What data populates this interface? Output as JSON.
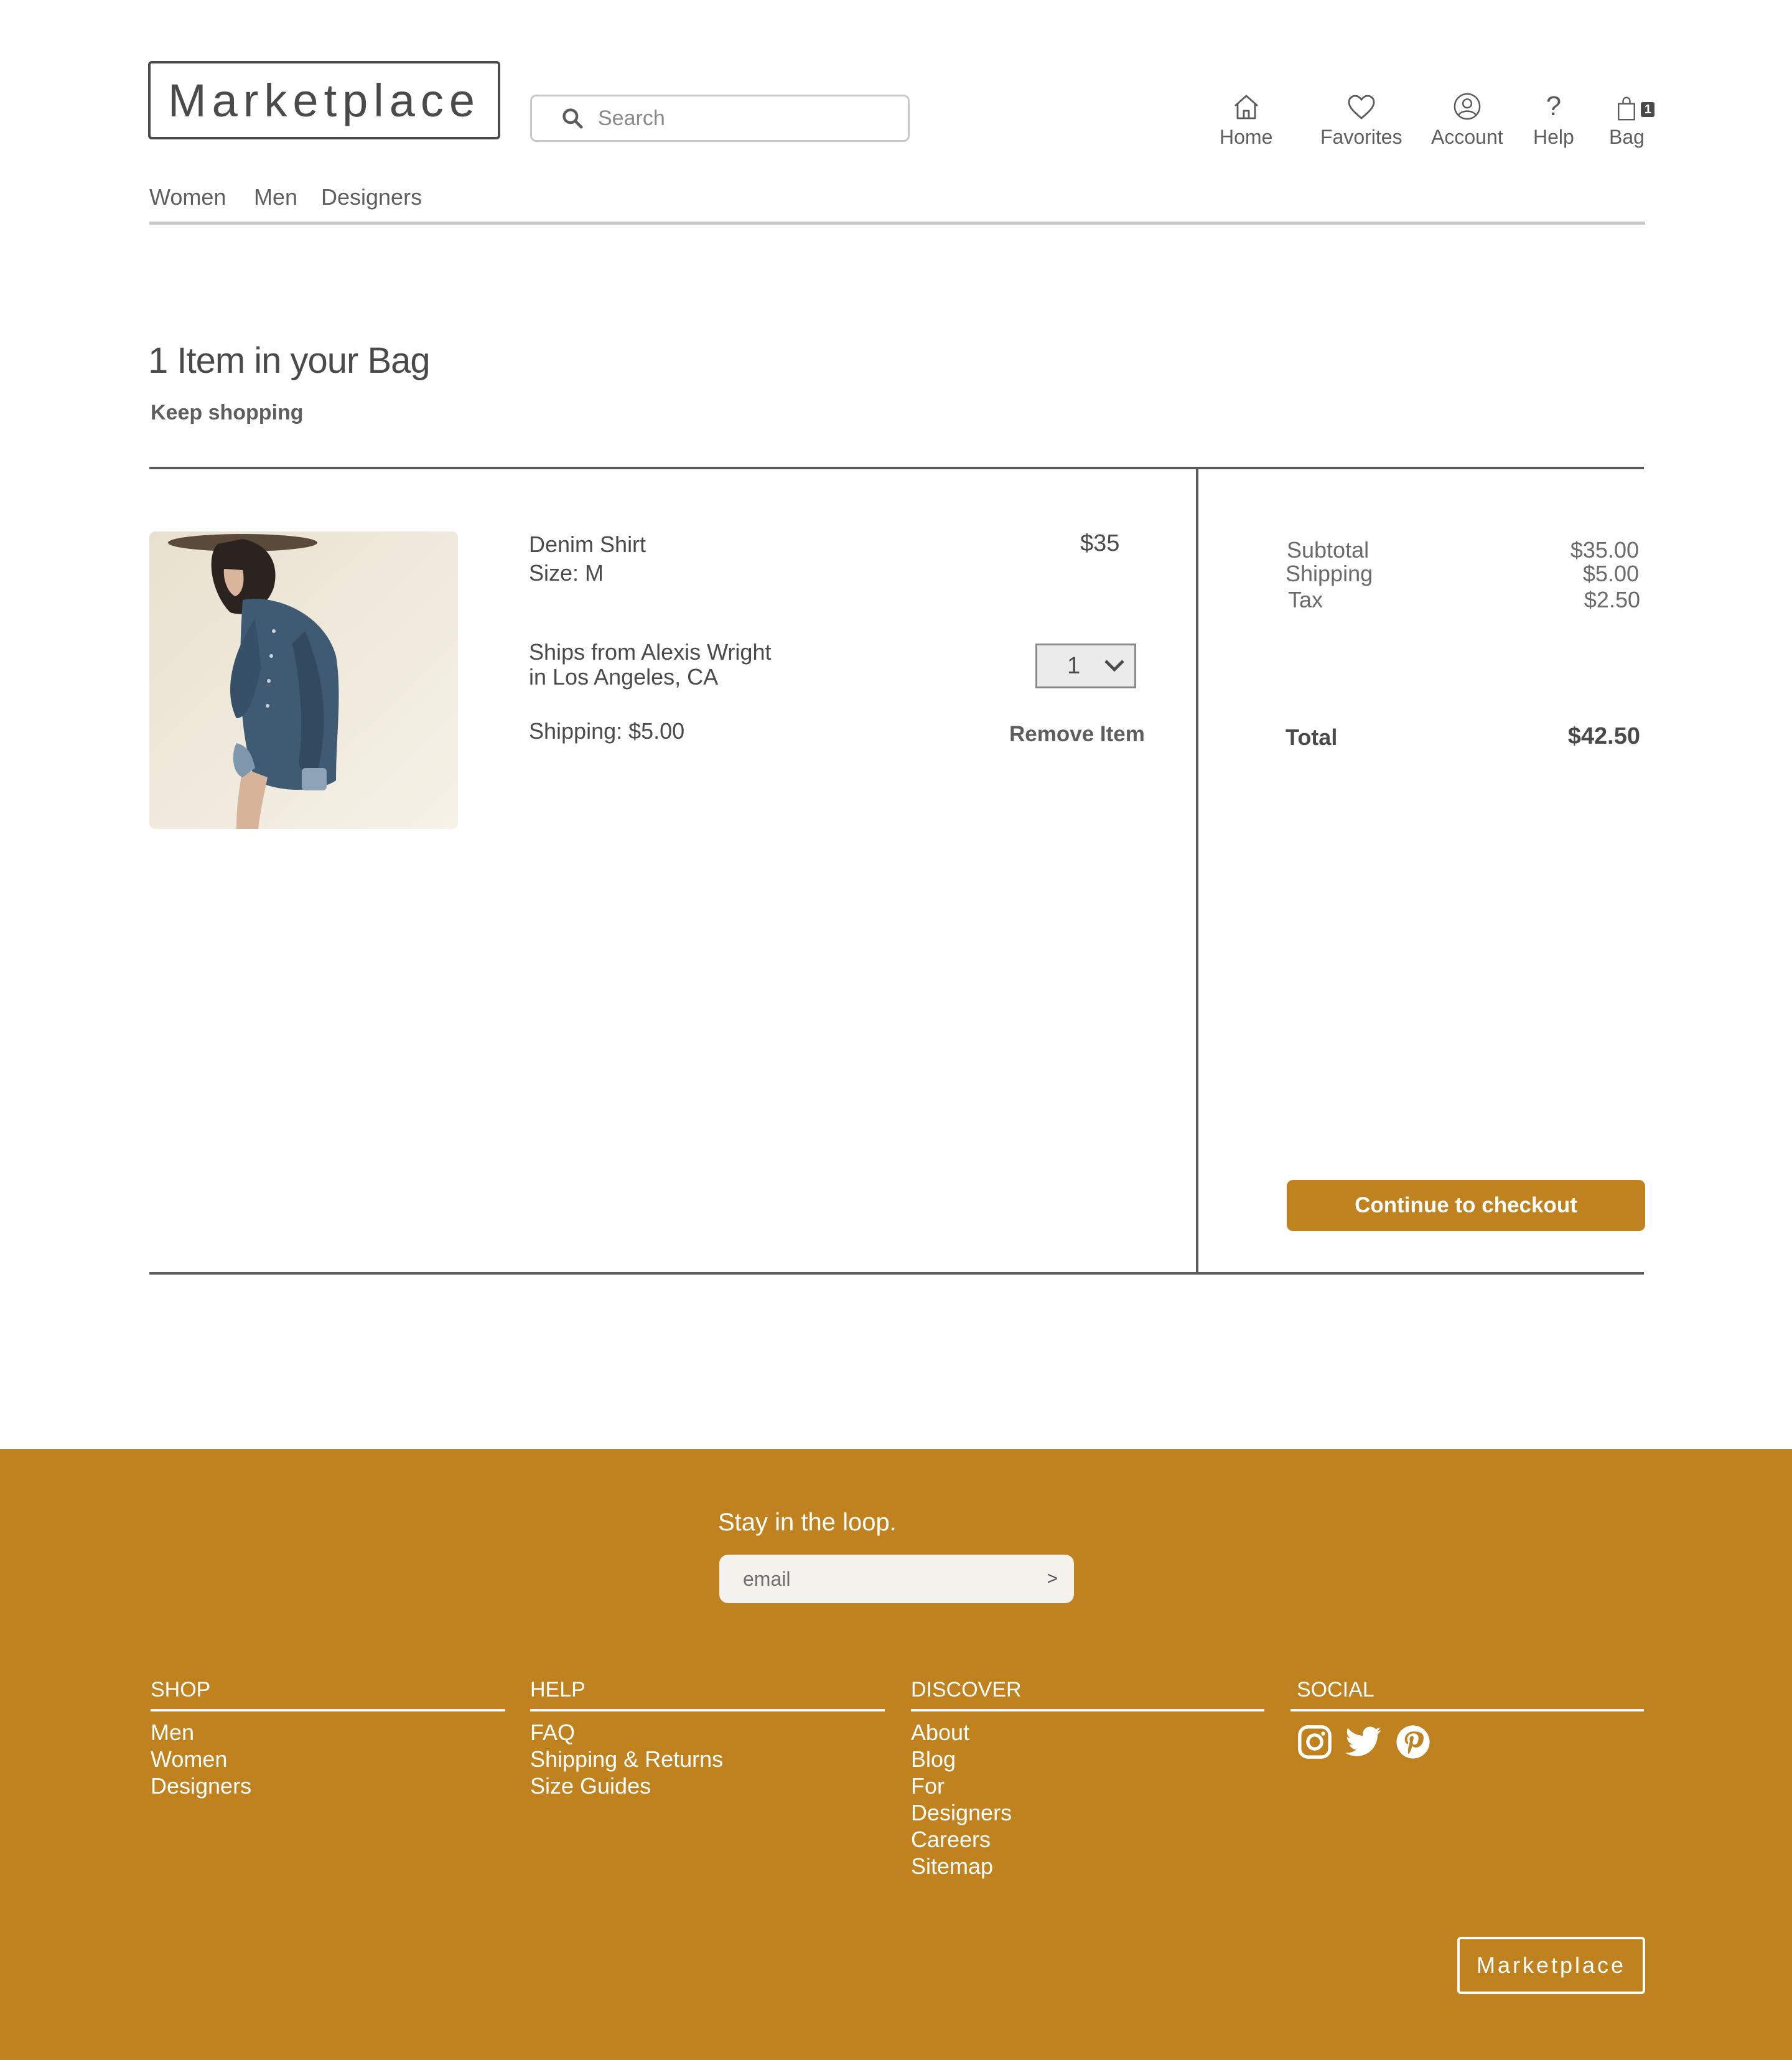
{
  "header": {
    "logo": "Marketplace",
    "search_placeholder": "Search",
    "nav": [
      {
        "label": "Home",
        "icon": "home-icon"
      },
      {
        "label": "Favorites",
        "icon": "heart-icon"
      },
      {
        "label": "Account",
        "icon": "account-icon"
      },
      {
        "label": "Help",
        "icon": "help-icon"
      },
      {
        "label": "Bag",
        "icon": "bag-icon",
        "badge": "1"
      }
    ],
    "categories": [
      "Women",
      "Men",
      "Designers"
    ]
  },
  "bag": {
    "title": "1 Item in your Bag",
    "keep_shopping": "Keep shopping",
    "item": {
      "name": "Denim Shirt",
      "size": "Size: M",
      "price": "$35",
      "ships_line1": "Ships from Alexis Wright",
      "ships_line2": "in Los Angeles, CA",
      "shipping": "Shipping: $5.00",
      "quantity": "1",
      "remove_label": "Remove Item"
    }
  },
  "summary": {
    "subtotal_label": "Subtotal",
    "subtotal_value": "$35.00",
    "shipping_label": "Shipping",
    "shipping_value": "$5.00",
    "tax_label": "Tax",
    "tax_value": "$2.50",
    "total_label": "Total",
    "total_value": "$42.50",
    "checkout_label": "Continue to checkout"
  },
  "footer": {
    "newsletter_title": "Stay in the loop.",
    "email_placeholder": "email",
    "submit_label": ">",
    "columns": {
      "shop": {
        "heading": "SHOP",
        "links": [
          "Men",
          "Women",
          "Designers"
        ]
      },
      "help": {
        "heading": "HELP",
        "links": [
          "FAQ",
          "Shipping & Returns",
          "Size Guides"
        ]
      },
      "discover": {
        "heading": "DISCOVER",
        "links": [
          "About",
          "Blog",
          "For",
          "Designers",
          "Careers",
          "Sitemap"
        ]
      },
      "social": {
        "heading": "SOCIAL",
        "icons": [
          "instagram-icon",
          "twitter-icon",
          "pinterest-icon"
        ]
      }
    },
    "logo": "Marketplace"
  },
  "colors": {
    "accent": "#bf821e",
    "text": "#4a4a4a",
    "divider": "#5a5a5a"
  }
}
